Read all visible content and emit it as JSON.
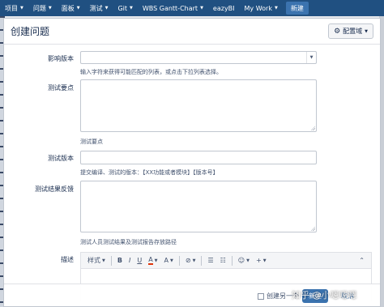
{
  "nav": {
    "items": [
      {
        "label": "项目",
        "caret": true
      },
      {
        "label": "问题",
        "caret": true
      },
      {
        "label": "面板",
        "caret": true
      },
      {
        "label": "测试",
        "caret": true
      },
      {
        "label": "Git",
        "caret": true
      },
      {
        "label": "WBS Gantt-Chart",
        "caret": true
      },
      {
        "label": "eazyBI",
        "caret": false
      },
      {
        "label": "My Work",
        "caret": true
      }
    ],
    "create_label": "新建"
  },
  "dialog": {
    "title": "创建问题",
    "config_label": "配置域"
  },
  "fields": {
    "affects_version": {
      "label": "影响版本",
      "value": "",
      "hint": "输入字符来获得可能匹配的列表，或点击下拉列表选择。"
    },
    "test_points": {
      "label": "测试要点",
      "value": "",
      "hint": "测试要点"
    },
    "test_version": {
      "label": "测试版本",
      "value": "",
      "hint": "提交编译、测试的版本：【XX功能或者模块】【版本号】"
    },
    "test_feedback": {
      "label": "测试结果反馈",
      "value": "",
      "hint": "测试人员测试结果及测试报告存放路径"
    },
    "description": {
      "label": "描述"
    }
  },
  "toolbar": {
    "style_label": "样式",
    "bold": "B",
    "italic": "I",
    "underline": "U",
    "text_color": "A",
    "more_format": "A",
    "link": "⊘",
    "bullet_list": "☰",
    "numbered_list": "☷",
    "emoji": "☺",
    "insert": "+",
    "collapse": "⌃"
  },
  "footer": {
    "create_another": "创建另一个",
    "create_button": "新建",
    "cancel_button": "取消"
  },
  "watermark": "知乎 @小嗯嗯嗯"
}
